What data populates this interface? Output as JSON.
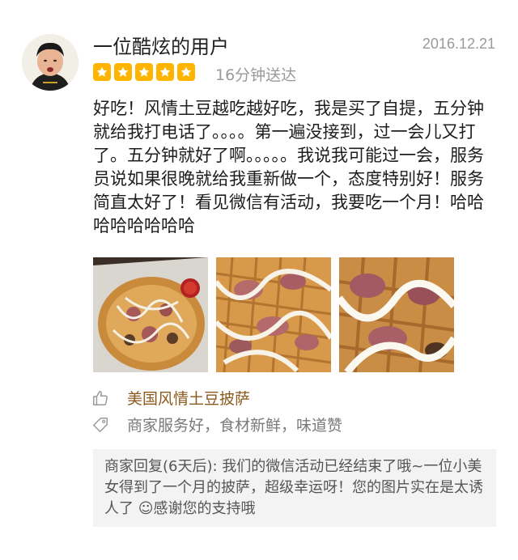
{
  "user": {
    "name": "一位酷炫的用户",
    "avatar_icon": "user-avatar"
  },
  "date": "2016.12.21",
  "rating": {
    "stars": 5,
    "max": 5,
    "star_color": "#ffb400"
  },
  "delivery_time": "16分钟送达",
  "content": "好吃！风情土豆越吃越好吃，我是买了自提，五分钟就给我打电话了。。。。第一遍没接到，过一会儿又打了。五分钟就好了啊。。。。。我说我可能过一会，服务员说如果很晚就给我重新做一个，态度特别好！服务简直太好了！看见微信有活动，我要吃一个月！哈哈哈哈哈哈哈哈",
  "photos": [
    {
      "icon": "pizza-photo"
    },
    {
      "icon": "pizza-closeup-photo"
    },
    {
      "icon": "pizza-macro-photo"
    }
  ],
  "recommended_dish": {
    "icon": "thumbs-up-icon",
    "label": "美国风情土豆披萨",
    "color": "#8b5a1e"
  },
  "tags": {
    "icon": "tag-icon",
    "label": "商家服务好，食材新鲜，味道赞"
  },
  "merchant_reply": {
    "text": "商家回复(6天后): 我们的微信活动已经结束了哦~一位小美女得到了一个月的披萨，超级幸运呀！您的图片实在是太诱人了 ☺感谢您的支持哦"
  }
}
